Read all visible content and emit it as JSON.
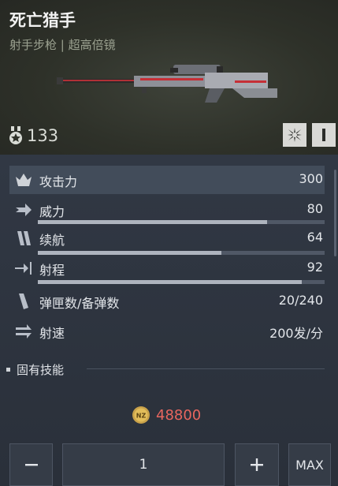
{
  "weapon": {
    "name": "死亡猎手",
    "subtitle": "射手步枪 | 超高倍镜",
    "level": "133"
  },
  "header_buttons": [
    {
      "icon": "spark-icon"
    },
    {
      "icon": "bar-icon"
    }
  ],
  "stats": [
    {
      "icon": "crown-icon",
      "label": "攻击力",
      "value": "300",
      "highlight": true
    },
    {
      "icon": "arrow-icon",
      "label": "威力",
      "value": "80",
      "progress": 0.8
    },
    {
      "icon": "speed-icon",
      "label": "续航",
      "value": "64",
      "progress": 0.64
    },
    {
      "icon": "range-icon",
      "label": "射程",
      "value": "92",
      "progress": 0.92
    },
    {
      "icon": "magazine-icon",
      "label": "弹匣数/备弹数",
      "value": "20/240"
    },
    {
      "icon": "firerate-icon",
      "label": "射速",
      "value": "200发/分"
    }
  ],
  "skills": {
    "title": "固有技能"
  },
  "price": {
    "currency_icon": "nz-coin-icon",
    "amount": "48800",
    "color": "#e8665f"
  },
  "quantity": {
    "minus": "−",
    "value": "1",
    "plus": "+",
    "max": "MAX"
  }
}
